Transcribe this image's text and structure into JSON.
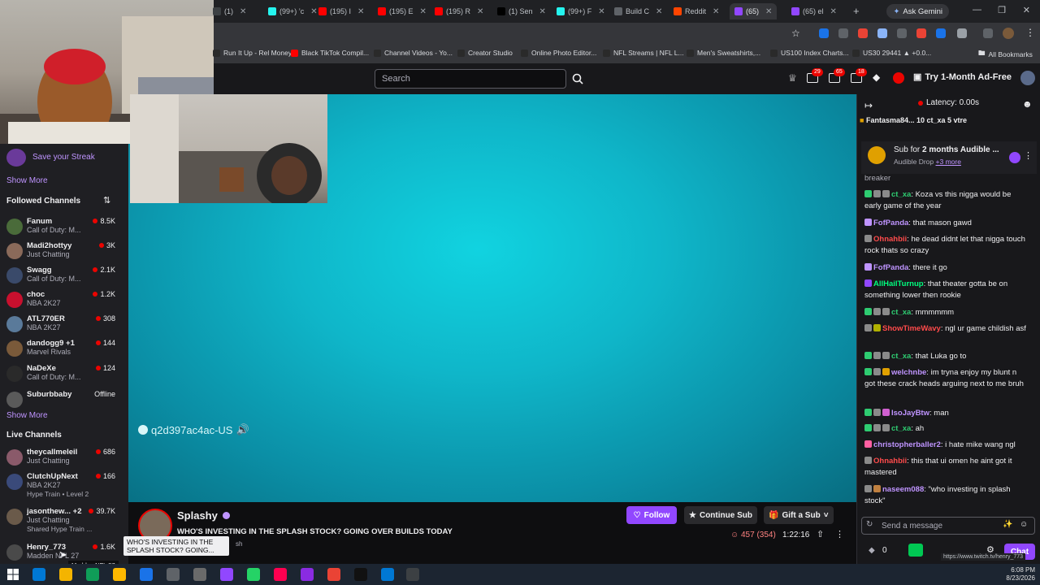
{
  "browser": {
    "tabs": [
      {
        "label": "(1)",
        "color": "#3c4043"
      },
      {
        "label": "(99+) ’c",
        "color": "#25f4ee"
      },
      {
        "label": "(195) I",
        "color": "#ff0000"
      },
      {
        "label": "(195) E",
        "color": "#ff0000"
      },
      {
        "label": "(195) R",
        "color": "#ff0000"
      },
      {
        "label": "(1) Sen",
        "color": "#000000"
      },
      {
        "label": "(99+) F",
        "color": "#25f4ee"
      },
      {
        "label": "Build C",
        "color": "#5f6368"
      },
      {
        "label": "Reddit",
        "color": "#ff4500"
      },
      {
        "label": "(65)",
        "color": "#9147ff"
      },
      {
        "label": "(65) el",
        "color": "#9147ff"
      }
    ],
    "gemini_label": "Ask Gemini",
    "bookmarks": [
      "Run It Up - Rel Money",
      "Black TikTok Compil...",
      "Channel Videos - Yo...",
      "Creator Studio",
      "Online Photo Editor...",
      "NFL Streams | NFL L...",
      "Men's Sweatshirts,...",
      "US100 Index Charts...",
      "US30 29441 ▲ +0.0..."
    ],
    "all_bookmarks": "All Bookmarks",
    "status_url": "https://www.twitch.tv/henry_773"
  },
  "topnav": {
    "search_placeholder": "Search",
    "badges": [
      "29",
      "65",
      "18"
    ],
    "ad_free": "Try 1-Month Ad-Free"
  },
  "sidebar": {
    "save_streak": "Save your Streak",
    "show_more_1": "Show More",
    "followed_title": "Followed Channels",
    "followed": [
      {
        "name": "Fanum",
        "game": "Call of Duty: M...",
        "viewers": "8.5K",
        "color": "#4a6b3a"
      },
      {
        "name": "Madi2hottyy",
        "game": "Just Chatting",
        "viewers": "3K",
        "color": "#8a6a5a"
      },
      {
        "name": "Swagg",
        "game": "Call of Duty: M...",
        "viewers": "2.1K",
        "color": "#3a4a6a"
      },
      {
        "name": "choc",
        "game": "NBA 2K27",
        "viewers": "1.2K",
        "color": "#c8102e"
      },
      {
        "name": "ATL770ER",
        "game": "NBA 2K27",
        "viewers": "308",
        "color": "#5a7a9a"
      },
      {
        "name": "dandogg9 +1",
        "game": "Marvel Rivals",
        "viewers": "144",
        "color": "#7a5a3a"
      },
      {
        "name": "NaDeXe",
        "game": "Call of Duty: M...",
        "viewers": "124",
        "color": "#2a2a2a"
      },
      {
        "name": "Suburbbaby",
        "game": "",
        "viewers": "Offline",
        "color": "#5a5a5a"
      }
    ],
    "show_more_2": "Show More",
    "live_title": "Live Channels",
    "live": [
      {
        "name": "theycallmeleil",
        "game": "Just Chatting",
        "viewers": "686",
        "extra": "",
        "color": "#8a5a6a"
      },
      {
        "name": "ClutchUpNext",
        "game": "NBA 2K27",
        "viewers": "166",
        "extra": "Hype Train • Level 2",
        "color": "#3a4a7a"
      },
      {
        "name": "jasonthew... +2",
        "game": "Just Chatting",
        "viewers": "39.7K",
        "extra": "Shared Hype Train ...",
        "color": "#6a5a4a"
      },
      {
        "name": "Henry_773",
        "game": "Madden NFL 27",
        "viewers": "1.6K",
        "extra": "",
        "color": "#4a4a4a"
      }
    ]
  },
  "video": {
    "psn_label": "q2d397ac4ac-US"
  },
  "stream": {
    "streamer": "Splashy",
    "title": "WHO'S INVESTING IN THE SPLASH STOCK? GOING OVER BUILDS TODAY",
    "follow": "Follow",
    "continue_sub": "Continue Sub",
    "gift_sub": "Gift a Sub",
    "viewers": "457 (354)",
    "uptime": "1:22:16",
    "tooltip": "WHO'S INVESTING IN THE SPLASH STOCK? GOING...",
    "tooltip2": "Madden NFL 27",
    "tag_suffix": "sh"
  },
  "chat": {
    "latency": "Latency: 0.00s",
    "gifters": "Fantasma84...  10   ct_xa  5   vtre",
    "pinned_title_prefix": "Sub for ",
    "pinned_title_bold": "2 months Audible ...",
    "pinned_sub": "Audible Drop",
    "pinned_more": "+3 more",
    "trunc_top": "breaker",
    "messages": [
      {
        "user": "ct_xa",
        "color": "#2ecc71",
        "text": "Koza vs this nigga would be early game of the year",
        "badges": [
          "#2ecc71",
          "#8a8a8a",
          "#8a8a8a"
        ]
      },
      {
        "user": "FofPanda",
        "color": "#bf94ff",
        "text": "that mason gawd",
        "badges": [
          "#bf94ff"
        ]
      },
      {
        "user": "Ohnahbii",
        "color": "#ff4b4b",
        "text": "he dead didnt let that nigga touch rock thats so crazy",
        "badges": [
          "#8a8a8a"
        ]
      },
      {
        "user": "FofPanda",
        "color": "#bf94ff",
        "text": "there it go",
        "badges": [
          "#bf94ff"
        ]
      },
      {
        "user": "AllHailTurnup",
        "color": "#00ff7f",
        "text": "that theater gotta be on something lower then rookie",
        "badges": [
          "#9147ff"
        ]
      },
      {
        "user": "ct_xa",
        "color": "#2ecc71",
        "text": "mmmmmm",
        "badges": [
          "#2ecc71",
          "#8a8a8a",
          "#8a8a8a"
        ]
      },
      {
        "user": "ShowTimeWavy",
        "color": "#ff4b4b",
        "text": "ngl ur game childish asf",
        "badges": [
          "#8a8a8a",
          "#b0b000"
        ]
      },
      {
        "user": "ct_xa",
        "color": "#2ecc71",
        "text": "that Luka go to",
        "badges": [
          "#2ecc71",
          "#8a8a8a",
          "#8a8a8a"
        ]
      },
      {
        "user": "welchnbe",
        "color": "#bf94ff",
        "text": "im tryna enjoy my blunt n got these crack heads arguing next to me bruh",
        "badges": [
          "#2ecc71",
          "#8a8a8a",
          "#e0a000"
        ]
      },
      {
        "user": "IsoJayBtw",
        "color": "#bf94ff",
        "text": "man",
        "badges": [
          "#2ecc71",
          "#8a8a8a",
          "#d060d0"
        ]
      },
      {
        "user": "ct_xa",
        "color": "#2ecc71",
        "text": "ah",
        "badges": [
          "#2ecc71",
          "#8a8a8a",
          "#8a8a8a"
        ]
      },
      {
        "user": "christopherballer2",
        "color": "#bf94ff",
        "text": "i hate mike wang ngl",
        "badges": [
          "#ff5fa2"
        ]
      },
      {
        "user": "Ohnahbii",
        "color": "#ff4b4b",
        "text": "this that ui omen he aint got it mastered",
        "badges": [
          "#8a8a8a"
        ]
      },
      {
        "user": "naseem088",
        "color": "#bf94ff",
        "text": "\"who investing in splash stock\"",
        "badges": [
          "#8a8a8a",
          "#c08040"
        ]
      }
    ],
    "input_placeholder": "Send a message",
    "points": "0",
    "chat_button": "Chat"
  },
  "taskbar": {
    "time": "6:08 PM",
    "date": "8/23/2026",
    "icon_colors": [
      "#0078d4",
      "#f4b400",
      "#0f9d58",
      "#ffb900",
      "#1a73e8",
      "#5f6368",
      "#6a6a6a",
      "#9147ff",
      "#25d366",
      "#ff0050",
      "#8a2be2",
      "#ea4335",
      "#111111",
      "#0078d4",
      "#3c4043"
    ]
  }
}
